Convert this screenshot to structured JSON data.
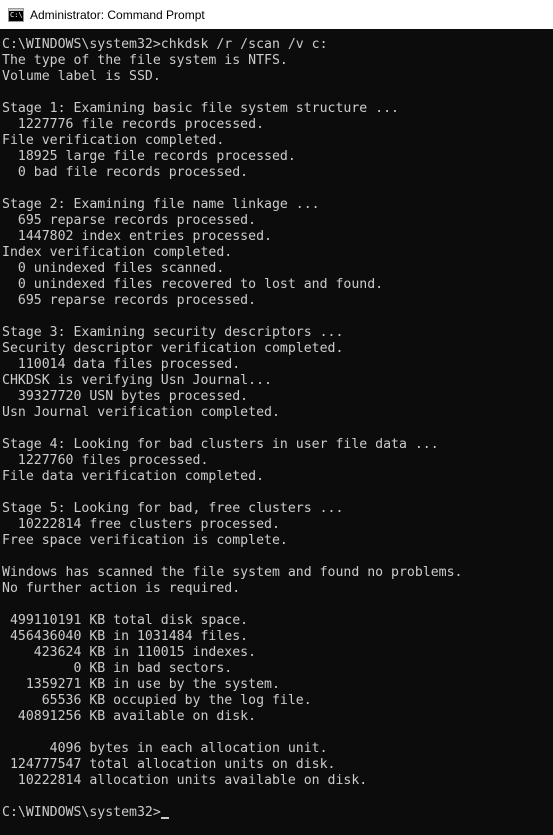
{
  "window": {
    "title": "Administrator: Command Prompt",
    "icon_glyph": "C:\\"
  },
  "console": {
    "lines": [
      "C:\\WINDOWS\\system32>chkdsk /r /scan /v c:",
      "The type of the file system is NTFS.",
      "Volume label is SSD.",
      "",
      "Stage 1: Examining basic file system structure ...",
      "  1227776 file records processed.",
      "File verification completed.",
      "  18925 large file records processed.",
      "  0 bad file records processed.",
      "",
      "Stage 2: Examining file name linkage ...",
      "  695 reparse records processed.",
      "  1447802 index entries processed.",
      "Index verification completed.",
      "  0 unindexed files scanned.",
      "  0 unindexed files recovered to lost and found.",
      "  695 reparse records processed.",
      "",
      "Stage 3: Examining security descriptors ...",
      "Security descriptor verification completed.",
      "  110014 data files processed.",
      "CHKDSK is verifying Usn Journal...",
      "  39327720 USN bytes processed.",
      "Usn Journal verification completed.",
      "",
      "Stage 4: Looking for bad clusters in user file data ...",
      "  1227760 files processed.",
      "File data verification completed.",
      "",
      "Stage 5: Looking for bad, free clusters ...",
      "  10222814 free clusters processed.",
      "Free space verification is complete.",
      "",
      "Windows has scanned the file system and found no problems.",
      "No further action is required.",
      "",
      " 499110191 KB total disk space.",
      " 456436040 KB in 1031484 files.",
      "    423624 KB in 110015 indexes.",
      "         0 KB in bad sectors.",
      "   1359271 KB in use by the system.",
      "     65536 KB occupied by the log file.",
      "  40891256 KB available on disk.",
      "",
      "      4096 bytes in each allocation unit.",
      " 124777547 total allocation units on disk.",
      "  10222814 allocation units available on disk.",
      ""
    ],
    "prompt": "C:\\WINDOWS\\system32>"
  }
}
